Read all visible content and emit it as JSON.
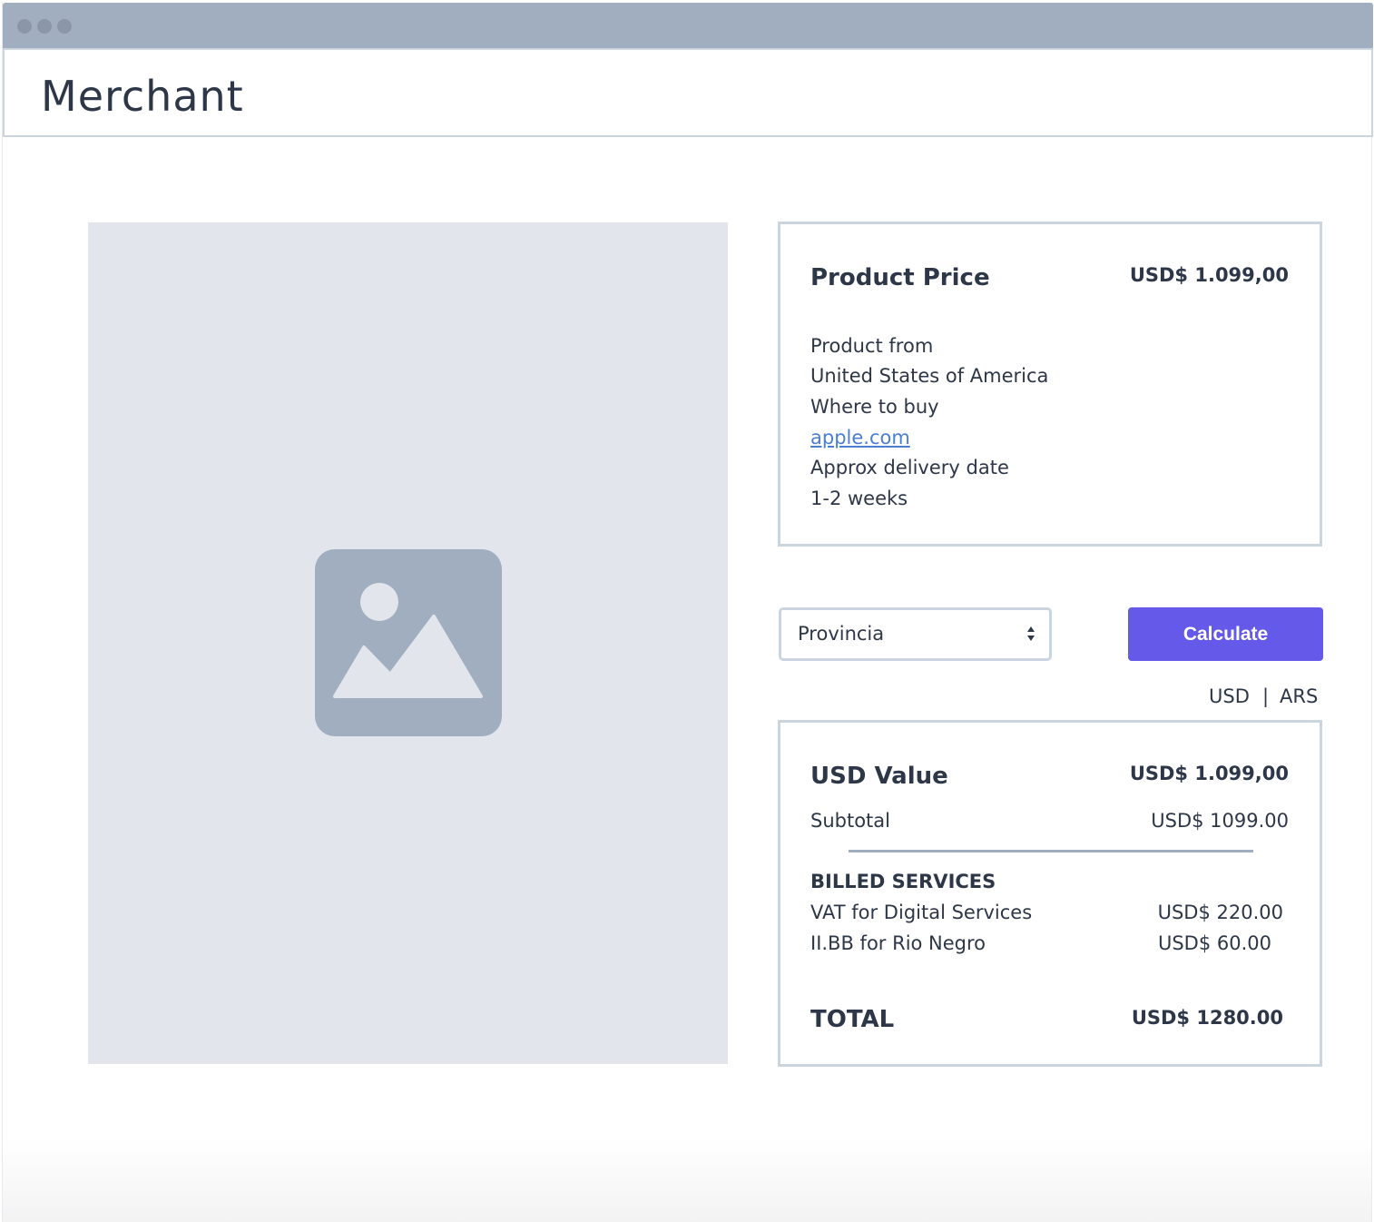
{
  "window": {
    "title": "Merchant"
  },
  "product_card": {
    "title": "Product Price",
    "price": "USD$ 1.099,00",
    "origin_label": "Product from",
    "origin_value": "United States of America",
    "where_label": "Where to buy",
    "where_link": "apple.com",
    "delivery_label": "Approx delivery date",
    "delivery_value": "1-2 weeks"
  },
  "controls": {
    "province_select": "Provincia",
    "calculate_label": "Calculate",
    "currency_usd": "USD",
    "currency_separator": "|",
    "currency_ars": "ARS"
  },
  "value_card": {
    "title": "USD Value",
    "title_amount": "USD$ 1.099,00",
    "subtotal_label": "Subtotal",
    "subtotal_amount": "USD$ 1099.00",
    "billed_heading": "BILLED SERVICES",
    "services": [
      {
        "label": "VAT for Digital Services",
        "amount": "USD$ 220.00"
      },
      {
        "label": "II.BB for Rio Negro",
        "amount": "USD$ 60.00"
      }
    ],
    "total_label": "TOTAL",
    "total_amount": "USD$ 1280.00"
  },
  "icons": {
    "window_dots": [
      "window-dot-icon",
      "window-dot-icon",
      "window-dot-icon"
    ],
    "image_placeholder": "image-placeholder-icon",
    "select_arrows": "updown-arrows-icon"
  },
  "colors": {
    "accent": "#6459e8",
    "link": "#4a7fd4",
    "border": "#cbd5e0",
    "titlebar": "#a0aec0",
    "image_bg": "#e2e6ec"
  }
}
